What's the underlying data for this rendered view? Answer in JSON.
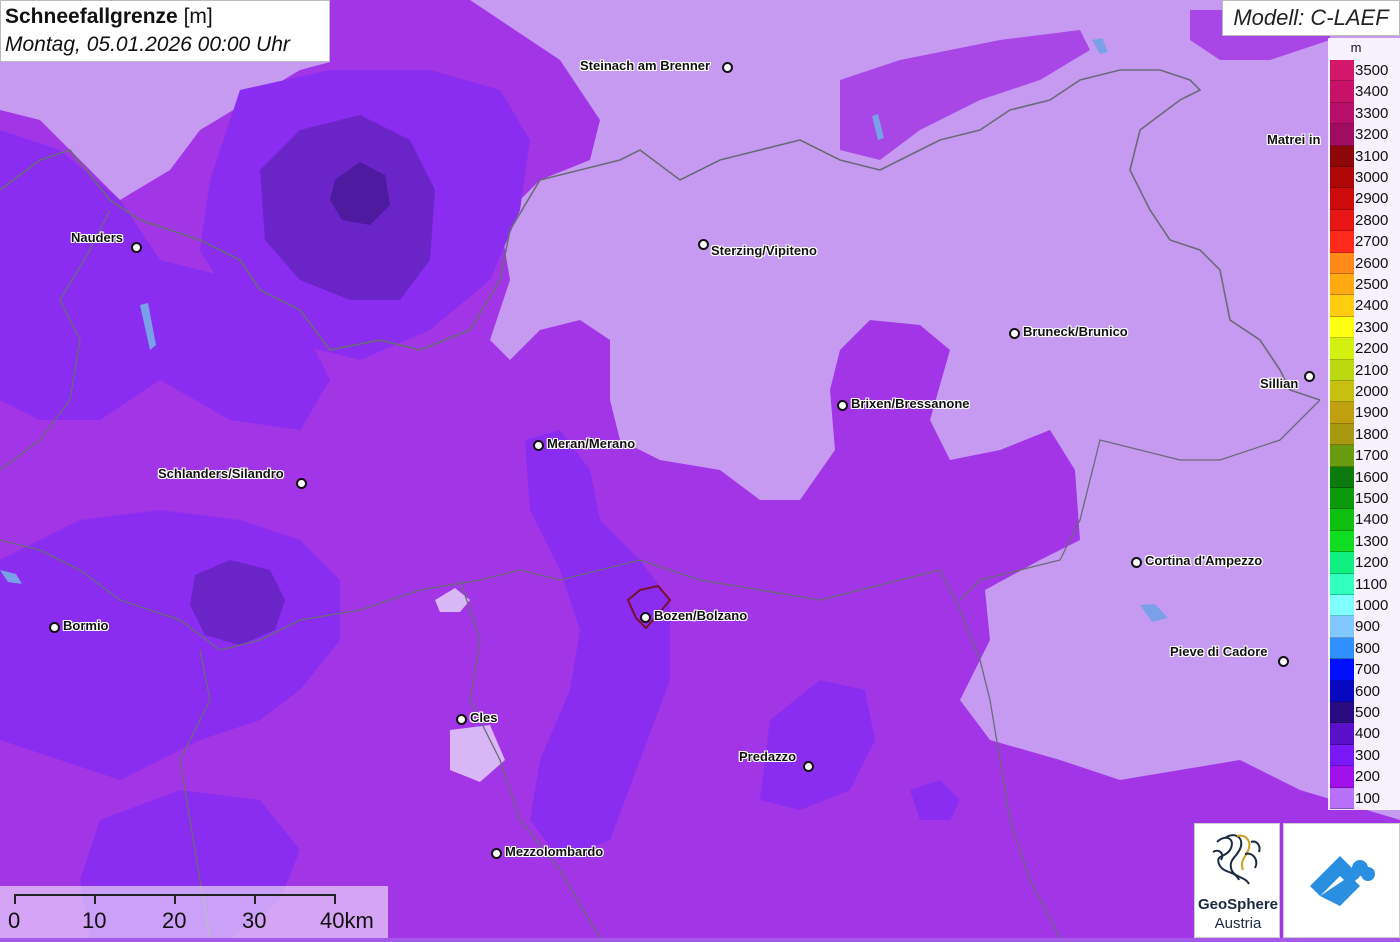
{
  "title": {
    "main": "Schneefallgrenze",
    "unit": "[m]",
    "datetime": "Montag, 05.01.2026 00:00 Uhr"
  },
  "model": "Modell: C-LAEF",
  "legend": {
    "unit": "m",
    "entries": [
      {
        "label": "3500",
        "color": "#d3176a"
      },
      {
        "label": "3400",
        "color": "#c8126a"
      },
      {
        "label": "3300",
        "color": "#b80f6a"
      },
      {
        "label": "3200",
        "color": "#a00c60"
      },
      {
        "label": "3100",
        "color": "#8c0808"
      },
      {
        "label": "3000",
        "color": "#b00808"
      },
      {
        "label": "2900",
        "color": "#cf0c0c"
      },
      {
        "label": "2800",
        "color": "#e81515"
      },
      {
        "label": "2700",
        "color": "#ff2a1a"
      },
      {
        "label": "2600",
        "color": "#ff8a1a"
      },
      {
        "label": "2500",
        "color": "#ffaa10"
      },
      {
        "label": "2400",
        "color": "#ffcc10"
      },
      {
        "label": "2300",
        "color": "#ffff10"
      },
      {
        "label": "2200",
        "color": "#d4f010"
      },
      {
        "label": "2100",
        "color": "#bcd810"
      },
      {
        "label": "2000",
        "color": "#c8c010"
      },
      {
        "label": "1900",
        "color": "#c0a010"
      },
      {
        "label": "1800",
        "color": "#a89810"
      },
      {
        "label": "1700",
        "color": "#6a9a10"
      },
      {
        "label": "1600",
        "color": "#0c7a0c"
      },
      {
        "label": "1500",
        "color": "#0c9a0c"
      },
      {
        "label": "1400",
        "color": "#10c010"
      },
      {
        "label": "1300",
        "color": "#10dc20"
      },
      {
        "label": "1200",
        "color": "#10f080"
      },
      {
        "label": "1100",
        "color": "#30ffc0"
      },
      {
        "label": "1000",
        "color": "#80ffff"
      },
      {
        "label": "900",
        "color": "#80c8ff"
      },
      {
        "label": "800",
        "color": "#3090ff"
      },
      {
        "label": "700",
        "color": "#0010ff"
      },
      {
        "label": "600",
        "color": "#0808c0"
      },
      {
        "label": "500",
        "color": "#2a0a80"
      },
      {
        "label": "400",
        "color": "#5a10c8"
      },
      {
        "label": "300",
        "color": "#7a18f8"
      },
      {
        "label": "200",
        "color": "#a010e8"
      },
      {
        "label": "100",
        "color": "#b870f8"
      }
    ]
  },
  "cities": [
    {
      "name": "Steinach am Brenner"
    },
    {
      "name": "Matrei in"
    },
    {
      "name": "Nauders"
    },
    {
      "name": "Sterzing/Vipiteno"
    },
    {
      "name": "Bruneck/Brunico"
    },
    {
      "name": "Sillian"
    },
    {
      "name": "Brixen/Bressanone"
    },
    {
      "name": "Meran/Merano"
    },
    {
      "name": "Schlanders/Silandro"
    },
    {
      "name": "Cortina d'Ampezzo"
    },
    {
      "name": "Bormio"
    },
    {
      "name": "Bozen/Bolzano"
    },
    {
      "name": "Pieve di Cadore"
    },
    {
      "name": "Cles"
    },
    {
      "name": "Predazzo"
    },
    {
      "name": "Mezzolombardo"
    }
  ],
  "scale": {
    "labels": [
      "0",
      "10",
      "20",
      "30",
      "40km"
    ]
  },
  "logos": {
    "geosphere_line1": "GeoSphere",
    "geosphere_line2": "Austria"
  }
}
